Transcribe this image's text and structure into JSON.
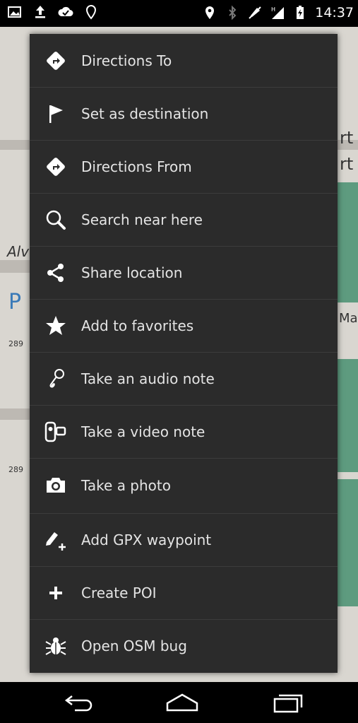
{
  "status_bar": {
    "time": "14:37",
    "left_icons": [
      "image-icon",
      "upload-icon",
      "cloud-check-icon",
      "location-pin-outline-icon"
    ],
    "right_icons": [
      "location-pin-icon",
      "bluetooth-icon",
      "muted-icon",
      "signal-icon",
      "battery-icon"
    ]
  },
  "map": {
    "visible_text": [
      "rt",
      "rt",
      "Alv",
      "Mas",
      "P",
      "289",
      "289"
    ]
  },
  "menu": {
    "items": [
      {
        "label": "Directions To",
        "icon": "directions-diamond-icon"
      },
      {
        "label": "Set as destination",
        "icon": "flag-icon"
      },
      {
        "label": "Directions From",
        "icon": "directions-diamond-icon"
      },
      {
        "label": "Search near here",
        "icon": "search-icon"
      },
      {
        "label": "Share location",
        "icon": "share-icon"
      },
      {
        "label": "Add to favorites",
        "icon": "star-icon"
      },
      {
        "label": "Take an audio note",
        "icon": "microphone-icon"
      },
      {
        "label": "Take a video note",
        "icon": "video-camera-icon"
      },
      {
        "label": "Take a photo",
        "icon": "camera-icon"
      },
      {
        "label": "Add GPX waypoint",
        "icon": "waypoint-pencil-icon"
      },
      {
        "label": "Create POI",
        "icon": "plus-icon"
      },
      {
        "label": "Open OSM bug",
        "icon": "bug-icon"
      }
    ]
  },
  "nav_bar": {
    "icons": [
      "back-icon",
      "home-icon",
      "recent-apps-icon"
    ]
  },
  "colors": {
    "menu_background": "#2b2b2b",
    "menu_text": "#e4e4e4",
    "divider": "#3c3c3c",
    "bar_background": "#000000"
  }
}
